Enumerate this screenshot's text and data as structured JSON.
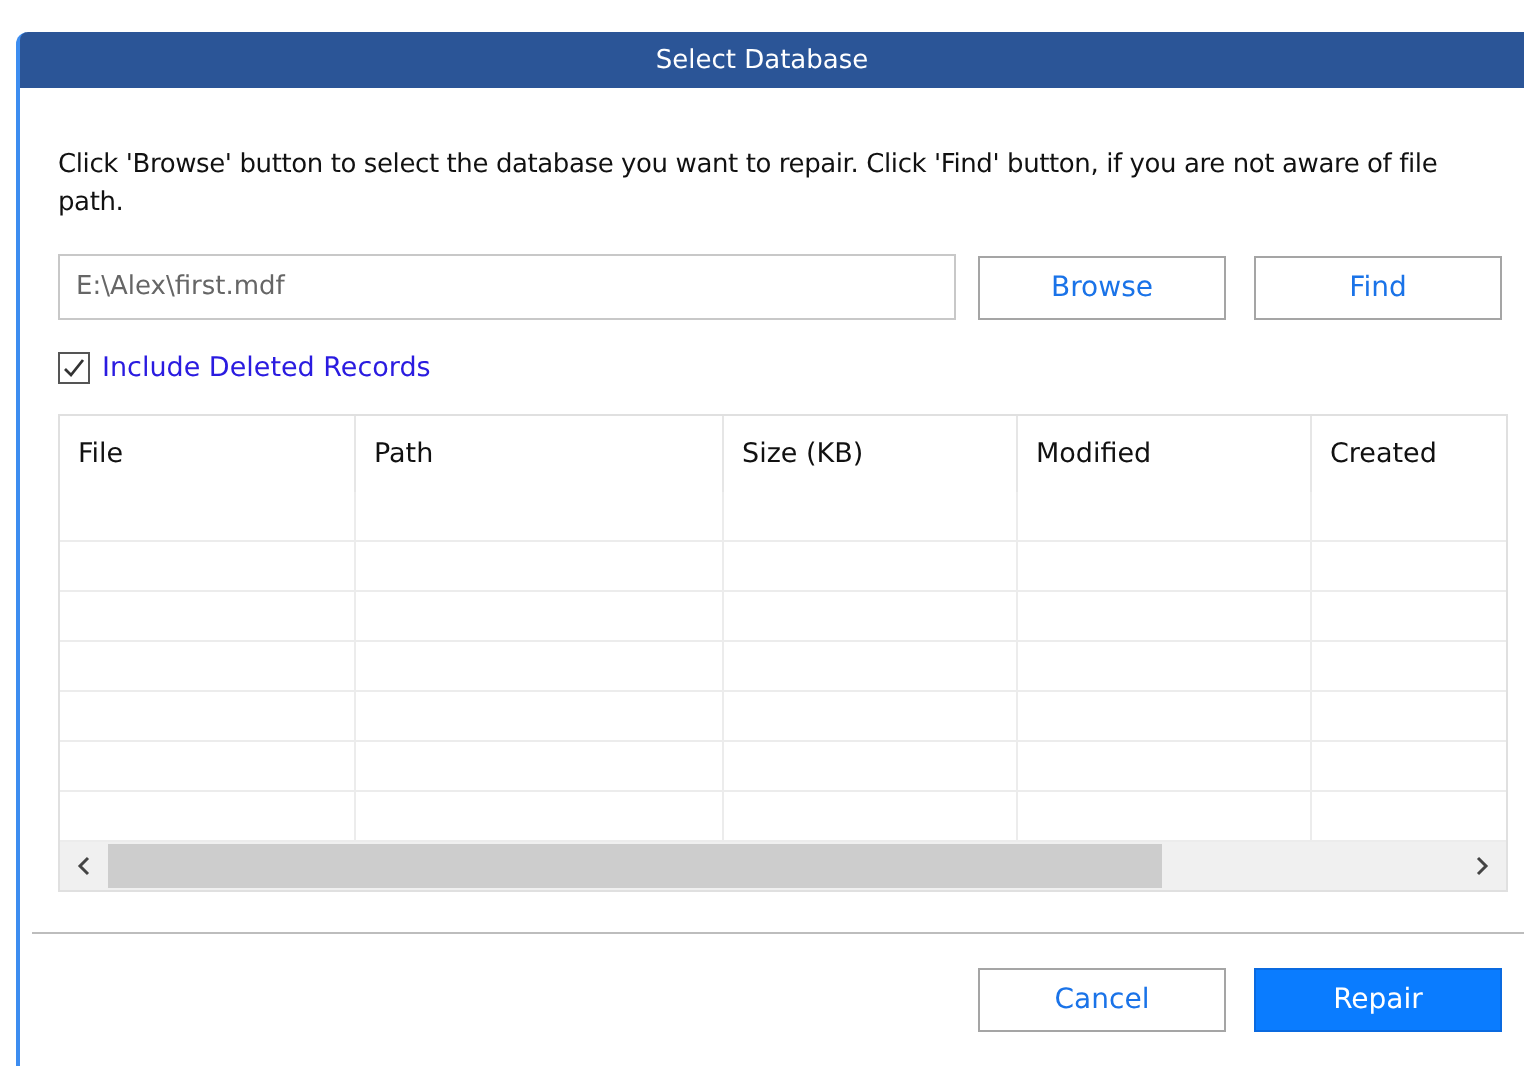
{
  "window": {
    "title": "Select Database"
  },
  "instructions": "Click 'Browse' button to select the database you want to repair. Click 'Find' button, if you are not aware of file path.",
  "path_field": {
    "value": "E:\\Alex\\first.mdf"
  },
  "top_buttons": [
    "Browse",
    "Find"
  ],
  "include_deleted": {
    "label": "Include Deleted Records",
    "checked": true
  },
  "table": {
    "columns": [
      "File",
      "Path",
      "Size (KB)",
      "Modified",
      "Created"
    ]
  },
  "footer_buttons": [
    {
      "label": "Cancel",
      "kind": "secondary"
    },
    {
      "label": "Repair",
      "kind": "primary"
    }
  ]
}
